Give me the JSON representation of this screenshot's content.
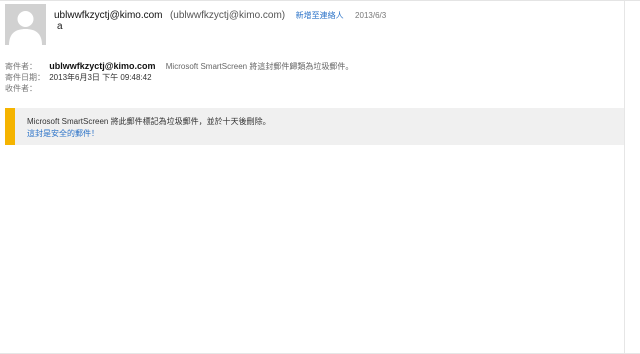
{
  "header": {
    "sender_name": "ublwwfkzyctj@kimo.com",
    "sender_address": "(ublwwfkzyctj@kimo.com)",
    "add_contact_label": "新增至連絡人",
    "date": "2013/6/3",
    "subject": "a"
  },
  "details": {
    "from_label": "寄件者：",
    "from_value": "ublwwfkzyctj@kimo.com",
    "from_note": "Microsoft SmartScreen 將這封郵件歸類為垃圾郵件。",
    "sent_label": "寄件日期：",
    "sent_value": "2013年6月3日 下午 09:48:42",
    "to_label": "收件者：",
    "to_value": ""
  },
  "junk_banner": {
    "message": "Microsoft SmartScreen 將此郵件標記為垃圾郵件，並於十天後刪除。",
    "safe_link": "這封是安全的郵件！",
    "accent_color": "#f5b400"
  },
  "icons": {
    "avatar": "person-silhouette-icon"
  }
}
